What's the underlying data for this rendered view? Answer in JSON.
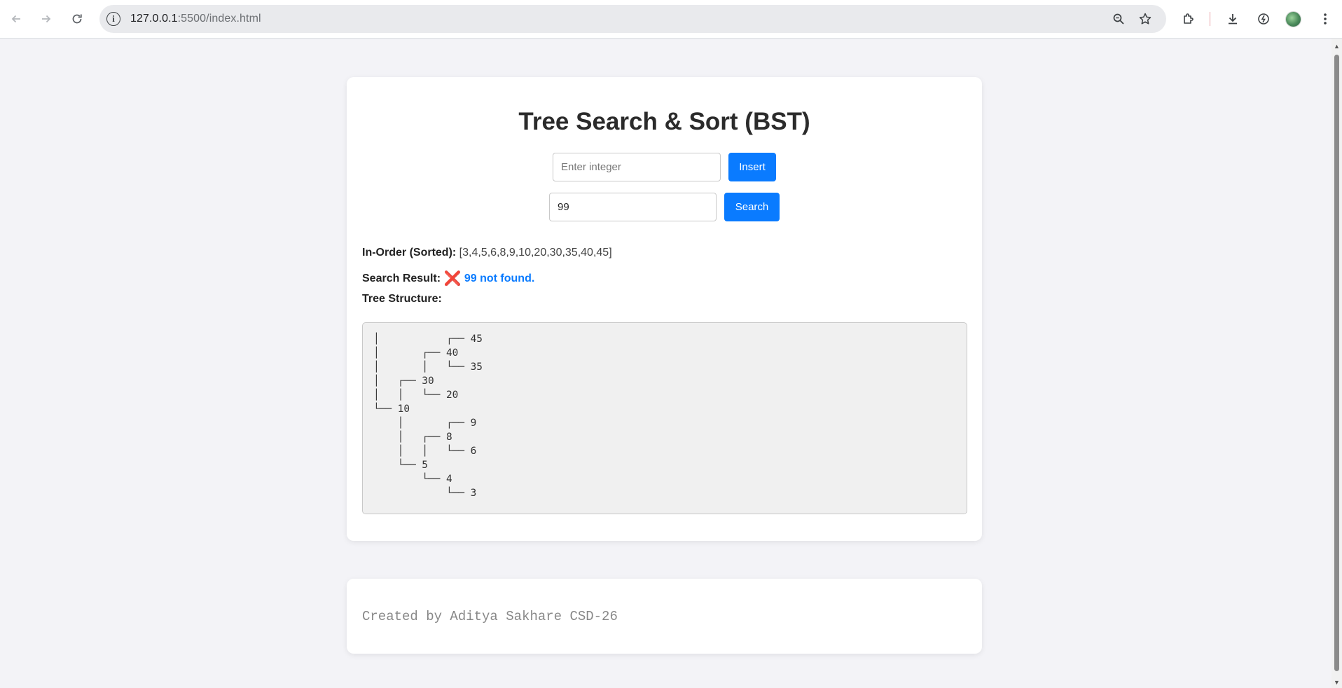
{
  "browser": {
    "url_host": "127.0.0.1",
    "url_rest": ":5500/index.html",
    "back_icon": "arrow-left-icon",
    "forward_icon": "arrow-right-icon",
    "reload_icon": "reload-icon"
  },
  "app": {
    "title": "Tree Search & Sort (BST)",
    "insert_input": {
      "value": "",
      "placeholder": "Enter integer"
    },
    "insert_button": "Insert",
    "search_input": {
      "value": "99",
      "placeholder": ""
    },
    "search_button": "Search",
    "inorder_label": "In-Order (Sorted):",
    "inorder_value": "[3,4,5,6,8,9,10,20,30,35,40,45]",
    "search_result_label": "Search Result:",
    "search_result_icon": "❌",
    "search_result_text": "99 not found.",
    "tree_label": "Tree Structure:",
    "tree_text": "│           ┌── 45\n│       ┌── 40\n│       │   └── 35\n│   ┌── 30\n│   │   └── 20\n└── 10\n    │       ┌── 9\n    │   ┌── 8\n    │   │   └── 6\n    └── 5\n        └── 4\n            └── 3"
  },
  "footer": {
    "text": "Created by Aditya Sakhare CSD-26"
  },
  "colors": {
    "accent": "#0a7bff",
    "error_icon": "#e0244f",
    "page_bg": "#f3f3f7"
  }
}
